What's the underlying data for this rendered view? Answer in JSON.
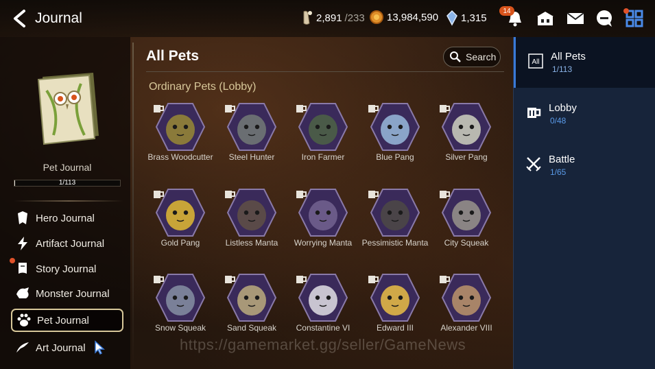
{
  "header": {
    "title": "Journal",
    "currencies": [
      {
        "icon": "stamina-icon",
        "value": "2,891",
        "max": "/233"
      },
      {
        "icon": "gold-icon",
        "value": "13,984,590"
      },
      {
        "icon": "skystone-icon",
        "value": "1,315"
      }
    ],
    "notification_count": "14"
  },
  "left": {
    "journal_name": "Pet Journal",
    "progress_text": "1/113",
    "progress_fraction": 0.009,
    "nav": [
      {
        "label": "Hero Journal",
        "icon": "hero-icon",
        "active": false
      },
      {
        "label": "Artifact Journal",
        "icon": "artifact-icon",
        "active": false
      },
      {
        "label": "Story Journal",
        "icon": "story-icon",
        "active": false
      },
      {
        "label": "Monster Journal",
        "icon": "monster-icon",
        "active": false
      },
      {
        "label": "Pet Journal",
        "icon": "paw-icon",
        "active": true
      },
      {
        "label": "Art Journal",
        "icon": "art-icon",
        "active": false
      }
    ]
  },
  "main": {
    "title": "All Pets",
    "search_label": "Search",
    "section_title": "Ordinary Pets (Lobby)",
    "pets": [
      {
        "name": "Brass Woodcutter",
        "color": "#8a7a3a"
      },
      {
        "name": "Steel Hunter",
        "color": "#6a6e72"
      },
      {
        "name": "Iron Farmer",
        "color": "#4a5a48"
      },
      {
        "name": "Blue Pang",
        "color": "#8aa4c8"
      },
      {
        "name": "Silver Pang",
        "color": "#b8b8b0"
      },
      {
        "name": "Gold Pang",
        "color": "#c8a438"
      },
      {
        "name": "Listless Manta",
        "color": "#5a4a48"
      },
      {
        "name": "Worrying Manta",
        "color": "#6a5a88"
      },
      {
        "name": "Pessimistic Manta",
        "color": "#4a4448"
      },
      {
        "name": "City Squeak",
        "color": "#8a8484"
      },
      {
        "name": "Snow Squeak",
        "color": "#7a8098"
      },
      {
        "name": "Sand Squeak",
        "color": "#a89878"
      },
      {
        "name": "Constantine VI",
        "color": "#c8c4d0"
      },
      {
        "name": "Edward III",
        "color": "#d0a848"
      },
      {
        "name": "Alexander VIII",
        "color": "#a88468"
      }
    ]
  },
  "categories": [
    {
      "label": "All Pets",
      "count": "1/113",
      "icon": "all-icon",
      "active": true
    },
    {
      "label": "Lobby",
      "count": "0/48",
      "icon": "mug-icon",
      "active": false
    },
    {
      "label": "Battle",
      "count": "1/65",
      "icon": "swords-icon",
      "active": false
    }
  ],
  "watermark": "https://gamemarket.gg/seller/GameNews",
  "colors": {
    "accent_blue": "#3a7ad8",
    "gold_text": "#d8c89a",
    "badge_orange": "#d8541c"
  }
}
